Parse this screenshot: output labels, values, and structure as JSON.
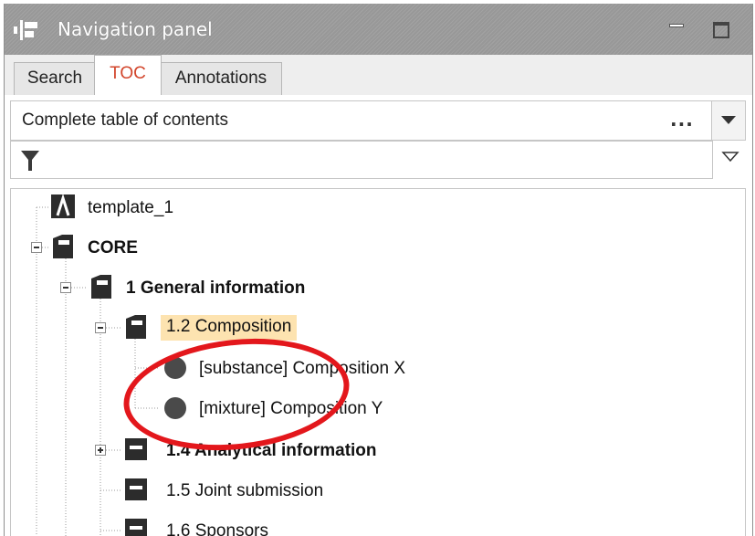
{
  "panel": {
    "title": "Navigation panel"
  },
  "tabs": [
    {
      "label": "Search"
    },
    {
      "label": "TOC",
      "active": true
    },
    {
      "label": "Annotations"
    }
  ],
  "toc_selector": {
    "value": "Complete table of contents",
    "more": "..."
  },
  "tree": {
    "nodes": [
      {
        "label": "template_1",
        "icon": "template-icon"
      },
      {
        "label": "CORE",
        "icon": "section-icon",
        "expanded": true
      },
      {
        "label": "1 General information",
        "icon": "section-icon",
        "expanded": true
      },
      {
        "label": "1.2 Composition",
        "icon": "section-icon",
        "expanded": true,
        "selected": true
      },
      {
        "label": "[substance] Composition X",
        "icon": "record-circle-icon"
      },
      {
        "label": "[mixture] Composition Y",
        "icon": "record-circle-icon"
      },
      {
        "label": "1.4 Analytical information",
        "icon": "section-icon",
        "expanded": false
      },
      {
        "label": "1.5 Joint submission",
        "icon": "section-icon"
      },
      {
        "label": "1.6 Sponsors",
        "icon": "section-icon"
      }
    ]
  },
  "colors": {
    "active_tab_text": "#d2452b",
    "selection_highlight": "#fde3b0",
    "annotation_circle": "#e3171c"
  }
}
